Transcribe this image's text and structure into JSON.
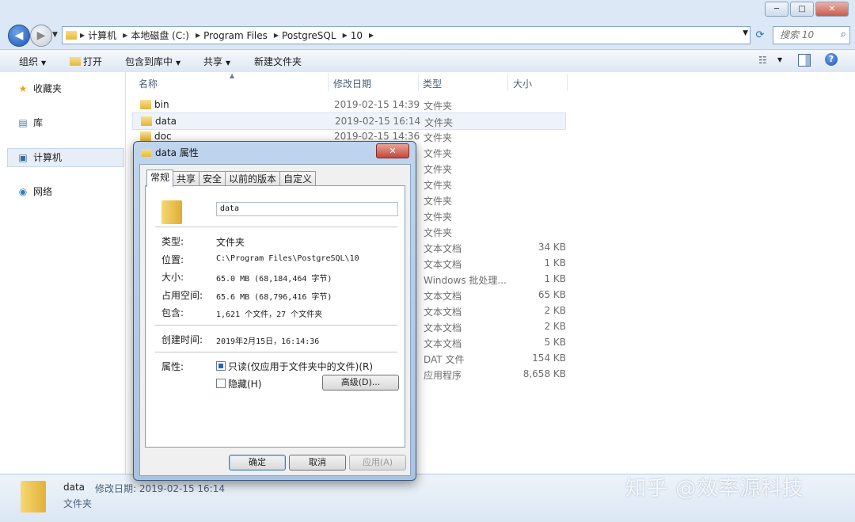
{
  "window": {
    "minimize": "─",
    "maximize": "□",
    "close": "✕"
  },
  "address": {
    "crumbs": [
      "计算机",
      "本地磁盘 (C:)",
      "Program Files",
      "PostgreSQL",
      "10"
    ],
    "search_placeholder": "搜索 10"
  },
  "toolbar": {
    "organize": "组织",
    "open": "打开",
    "include": "包含到库中",
    "share": "共享",
    "new_folder": "新建文件夹"
  },
  "nav": {
    "favorites": "收藏夹",
    "libraries": "库",
    "computer": "计算机",
    "network": "网络"
  },
  "columns": {
    "name": "名称",
    "date": "修改日期",
    "type": "类型",
    "size": "大小"
  },
  "files": [
    {
      "name": "bin",
      "date": "2019-02-15 14:39",
      "type": "文件夹",
      "size": ""
    },
    {
      "name": "data",
      "date": "2019-02-15 16:14",
      "type": "文件夹",
      "size": ""
    },
    {
      "name": "doc",
      "date": "2019-02-15 14:36",
      "type": "文件夹",
      "size": ""
    },
    {
      "name": "",
      "date": "",
      "type": "文件夹",
      "size": ""
    },
    {
      "name": "",
      "date": "",
      "type": "文件夹",
      "size": ""
    },
    {
      "name": "",
      "date": "",
      "type": "文件夹",
      "size": ""
    },
    {
      "name": "",
      "date": "",
      "type": "文件夹",
      "size": ""
    },
    {
      "name": "",
      "date": "",
      "type": "文件夹",
      "size": ""
    },
    {
      "name": "",
      "date": "",
      "type": "文件夹",
      "size": ""
    },
    {
      "name": "",
      "date": "",
      "type": "文本文档",
      "size": "34 KB"
    },
    {
      "name": "",
      "date": "",
      "type": "文本文档",
      "size": "1 KB"
    },
    {
      "name": "",
      "date": "",
      "type": "Windows 批处理...",
      "size": "1 KB"
    },
    {
      "name": "",
      "date": "",
      "type": "文本文档",
      "size": "65 KB"
    },
    {
      "name": "",
      "date": "",
      "type": "文本文档",
      "size": "2 KB"
    },
    {
      "name": "",
      "date": "",
      "type": "文本文档",
      "size": "2 KB"
    },
    {
      "name": "",
      "date": "",
      "type": "文本文档",
      "size": "5 KB"
    },
    {
      "name": "",
      "date": "",
      "type": "DAT 文件",
      "size": "154 KB"
    },
    {
      "name": "",
      "date": "",
      "type": "应用程序",
      "size": "8,658 KB"
    }
  ],
  "status": {
    "name": "data",
    "modified": "修改日期: 2019-02-15 16:14",
    "type": "文件夹"
  },
  "watermark": "知乎 @效率源科技",
  "dialog": {
    "title": "data 属性",
    "close": "✕",
    "tabs": [
      "常规",
      "共享",
      "安全",
      "以前的版本",
      "自定义"
    ],
    "name_value": "data",
    "props": {
      "type_label": "类型:",
      "type_value": "文件夹",
      "location_label": "位置:",
      "location_value": "C:\\Program Files\\PostgreSQL\\10",
      "size_label": "大小:",
      "size_value": "65.0 MB (68,184,464 字节)",
      "disk_label": "占用空间:",
      "disk_value": "65.6 MB (68,796,416 字节)",
      "contains_label": "包含:",
      "contains_value": "1,621 个文件，27 个文件夹",
      "created_label": "创建时间:",
      "created_value": "2019年2月15日，16:14:36",
      "attr_label": "属性:",
      "readonly": "只读(仅应用于文件夹中的文件)(R)",
      "hidden": "隐藏(H)",
      "advanced": "高级(D)..."
    },
    "buttons": {
      "ok": "确定",
      "cancel": "取消",
      "apply": "应用(A)"
    }
  }
}
